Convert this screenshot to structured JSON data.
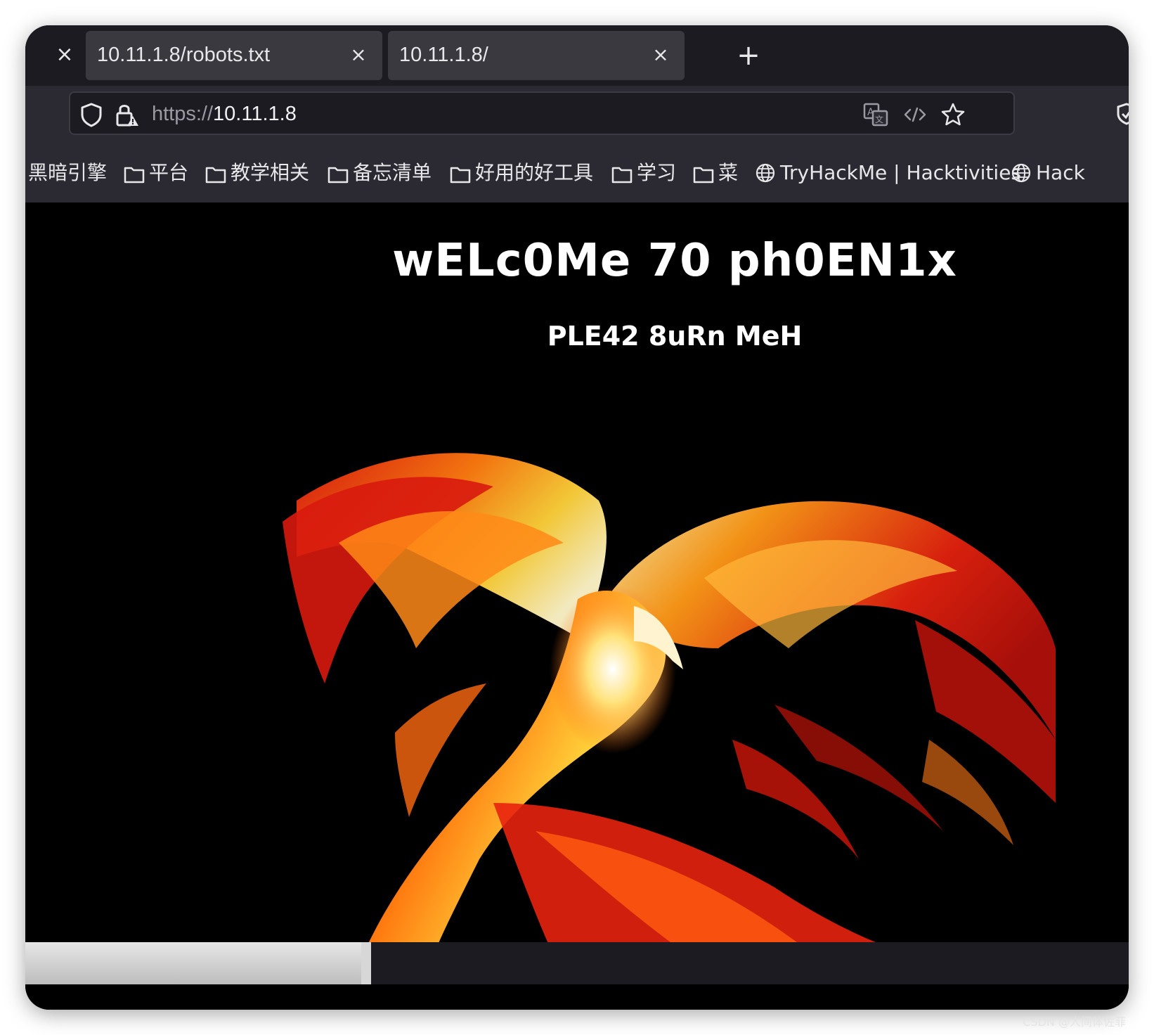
{
  "browser": {
    "tabs": [
      {
        "title": "10.11.1.8/robots.txt",
        "close": "×"
      },
      {
        "title": "10.11.1.8/",
        "close": "×"
      }
    ],
    "strip_close": "×",
    "new_tab": "+",
    "url": {
      "scheme": "https://",
      "host": "10.11.1.8"
    },
    "icons": {
      "shield": "shield-icon",
      "lock": "lock-warning-icon",
      "translate": "translate-icon",
      "code": "code-icon",
      "star": "star-icon",
      "extension": "shield-check-icon"
    }
  },
  "bookmarks": [
    {
      "label": "黑暗引擎",
      "icon": "none"
    },
    {
      "label": "平台",
      "icon": "folder-icon"
    },
    {
      "label": "教学相关",
      "icon": "folder-icon"
    },
    {
      "label": "备忘清单",
      "icon": "folder-icon"
    },
    {
      "label": "好用的好工具",
      "icon": "folder-icon"
    },
    {
      "label": "学习",
      "icon": "folder-icon"
    },
    {
      "label": "菜",
      "icon": "folder-icon"
    },
    {
      "label": "TryHackMe | Hacktivities",
      "icon": "globe-icon"
    },
    {
      "label": "Hack",
      "icon": "globe-icon"
    }
  ],
  "page": {
    "heading": "wELc0Me 70 ph0EN1x",
    "subheading": "PLE42 8uRn MeH",
    "image": "phoenix-image"
  },
  "watermark": "CSDN @人间体佐菲"
}
